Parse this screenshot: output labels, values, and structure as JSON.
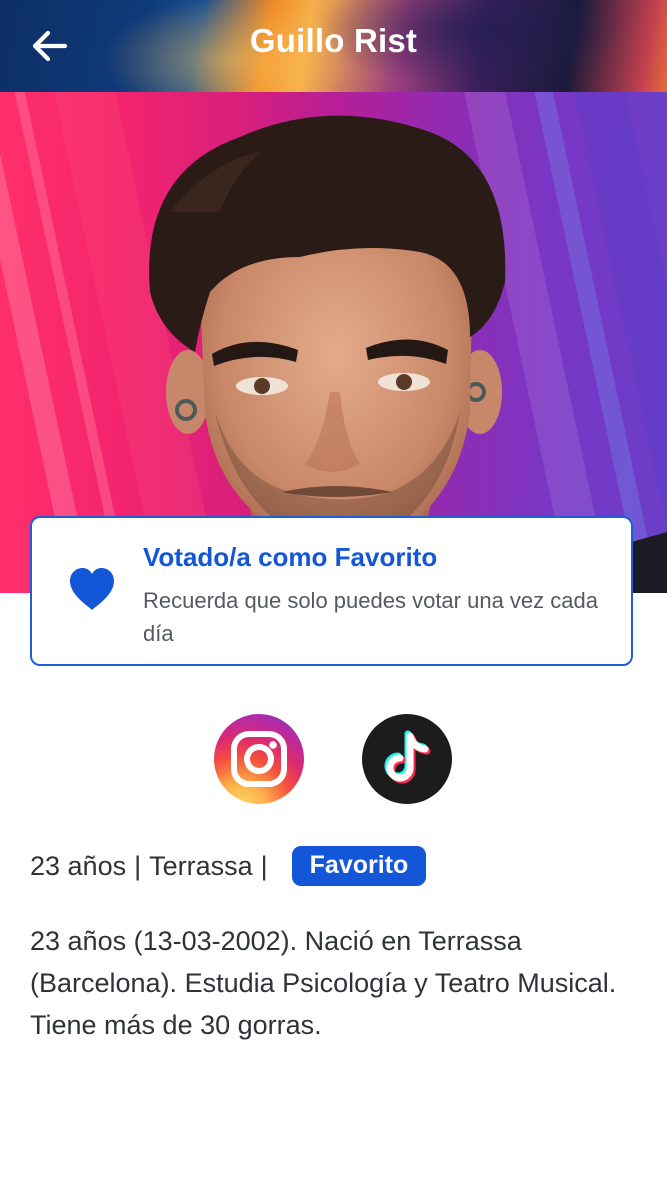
{
  "header": {
    "title": "Guillo Rist",
    "back_icon": "arrow-left-icon"
  },
  "hero": {
    "image": "contestant-portrait"
  },
  "vote_card": {
    "icon": "heart-icon",
    "title": "Votado/a como Favorito",
    "subtitle": "Recuerda que solo puedes votar una vez cada día"
  },
  "social": [
    {
      "name": "Instagram",
      "icon": "instagram-icon"
    },
    {
      "name": "TikTok",
      "icon": "tiktok-icon"
    }
  ],
  "info": {
    "age": "23 años",
    "separator": "|",
    "city": "Terrassa",
    "badge": "Favorito"
  },
  "bio": "23 años (13-03-2002). Nació en Terrassa (Barcelona). Estudia Psicología y Teatro Musical. Tiene más de 30 gorras.",
  "colors": {
    "accent": "#1357d8",
    "text": "#2f3338",
    "muted": "#555a60"
  }
}
